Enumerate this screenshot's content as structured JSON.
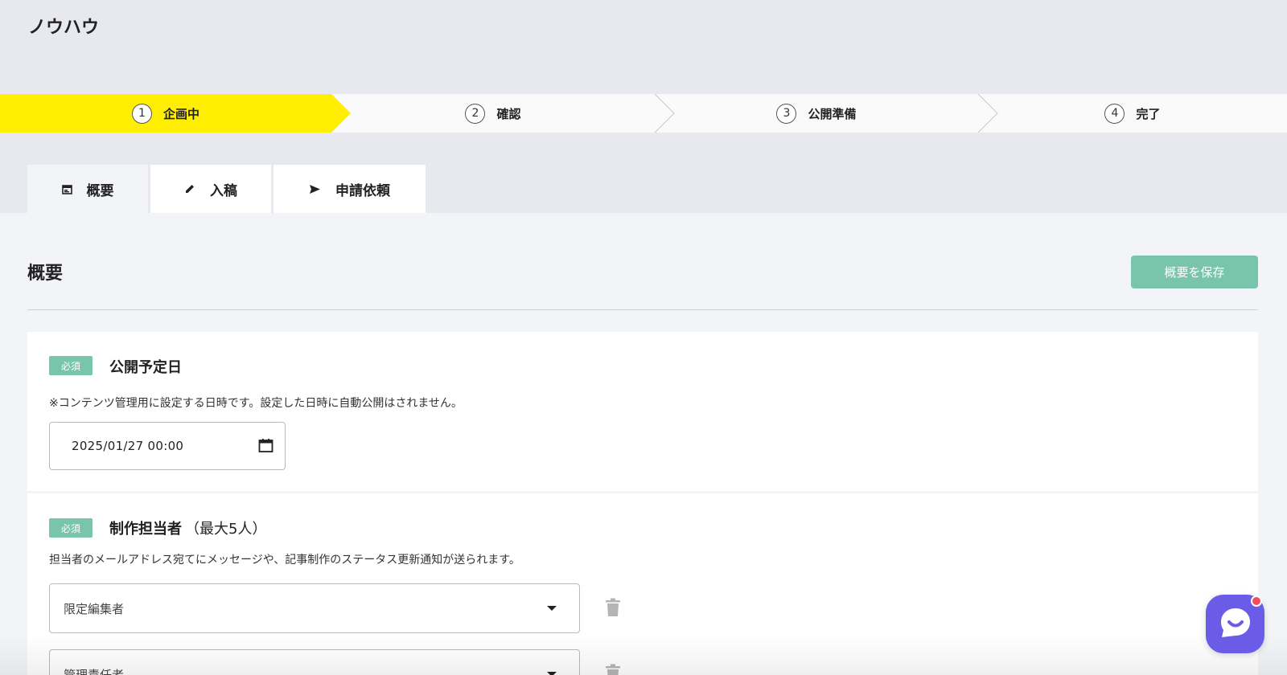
{
  "app": {
    "title": "ノウハウ"
  },
  "stepper": {
    "active_color": "#ffee00",
    "steps": [
      {
        "number": "1",
        "label": "企画中",
        "active": true
      },
      {
        "number": "2",
        "label": "確認",
        "active": false
      },
      {
        "number": "3",
        "label": "公開準備",
        "active": false
      },
      {
        "number": "4",
        "label": "完了",
        "active": false
      }
    ]
  },
  "tabs": [
    {
      "label": "概要",
      "icon": "calendar-icon",
      "active": true
    },
    {
      "label": "入稿",
      "icon": "pencil-icon",
      "active": false
    },
    {
      "label": "申請依頼",
      "icon": "send-icon",
      "active": false
    }
  ],
  "section": {
    "title": "概要",
    "save_label": "概要を保存"
  },
  "accent_color": "#79c5ab",
  "fields": {
    "publish_date": {
      "badge": "必須",
      "label": "公開予定日",
      "description": "※コンテンツ管理用に設定する日時です。設定した日時に自動公開はされません。",
      "value": "2025/01/27 00:00"
    },
    "assignees": {
      "badge": "必須",
      "label": "制作担当者",
      "sublabel": "（最大5人）",
      "description": "担当者のメールアドレス宛てにメッセージや、記事制作のステータス更新通知が送られます。",
      "selects": [
        "限定編集者",
        "管理責任者"
      ]
    }
  },
  "chat": {
    "icon": "chat-icon",
    "brand_color": "#6b5ce7",
    "notification_color": "#f24d5a"
  }
}
